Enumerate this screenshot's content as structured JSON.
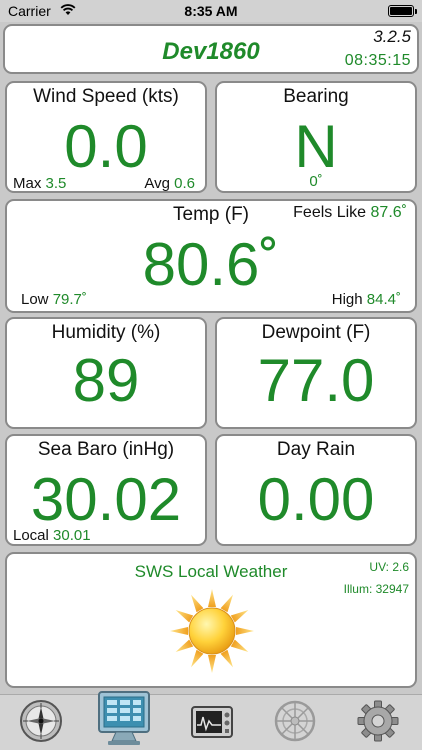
{
  "status_bar": {
    "carrier": "Carrier",
    "time": "8:35 AM"
  },
  "header": {
    "title": "Dev1860",
    "version": "3.2.5",
    "clock": "08:35:15"
  },
  "wind": {
    "label": "Wind Speed (kts)",
    "value": "0.0",
    "max_label": "Max",
    "max_value": "3.5",
    "avg_label": "Avg",
    "avg_value": "0.6"
  },
  "bearing": {
    "label": "Bearing",
    "value": "N",
    "degrees": "0˚"
  },
  "temp": {
    "label": "Temp (F)",
    "value": "80.6˚",
    "feels_like_label": "Feels Like",
    "feels_like_value": "87.6˚",
    "low_label": "Low",
    "low_value": "79.7˚",
    "high_label": "High",
    "high_value": "84.4˚"
  },
  "humidity": {
    "label": "Humidity (%)",
    "value": "89"
  },
  "dewpoint": {
    "label": "Dewpoint (F)",
    "value": "77.0"
  },
  "baro": {
    "label": "Sea Baro (inHg)",
    "value": "30.02",
    "local_label": "Local",
    "local_value": "30.01"
  },
  "rain": {
    "label": "Day Rain",
    "value": "0.00"
  },
  "forecast": {
    "title": "SWS Local Weather",
    "uv": "UV: 2.6",
    "illum": "Illum: 32947",
    "icon": "sun-icon"
  },
  "tabs": [
    {
      "icon": "compass-icon"
    },
    {
      "icon": "monitor-icon",
      "selected": true
    },
    {
      "icon": "oscilloscope-icon"
    },
    {
      "icon": "wheel-icon"
    },
    {
      "icon": "gear-icon"
    }
  ],
  "colors": {
    "value_green": "#1f8a2a",
    "panel_border": "#8a8a8a",
    "background": "#c9c9c9"
  }
}
